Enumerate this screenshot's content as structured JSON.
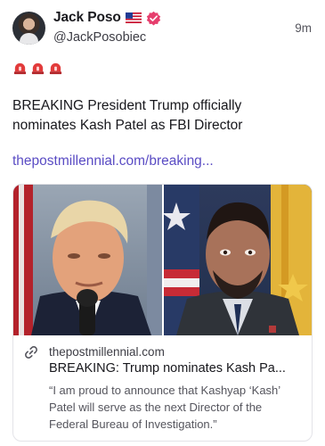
{
  "author": {
    "display_name": "Jack Poso",
    "handle": "@JackPosobiec",
    "badges": [
      "us-flag-icon",
      "verified-badge-icon"
    ]
  },
  "post": {
    "timestamp": "9m",
    "emoji": [
      "siren-icon",
      "siren-icon",
      "siren-icon"
    ],
    "text": "BREAKING President Trump officially nominates Kash Patel as FBI Director",
    "link_text": "thepostmillennial.com/breaking..."
  },
  "link_card": {
    "domain": "thepostmillennial.com",
    "title": "BREAKING: Trump nominates Kash Pa...",
    "description": "“I am proud to announce that Kashyap ‘Kash’ Patel will serve as the next Director of the Federal Bureau of Investigation.”",
    "images": [
      "photo-trump",
      "photo-patel"
    ]
  },
  "colors": {
    "link": "#5a4cc4",
    "verified": "#e63e6d",
    "siren": "#e23b3b"
  }
}
